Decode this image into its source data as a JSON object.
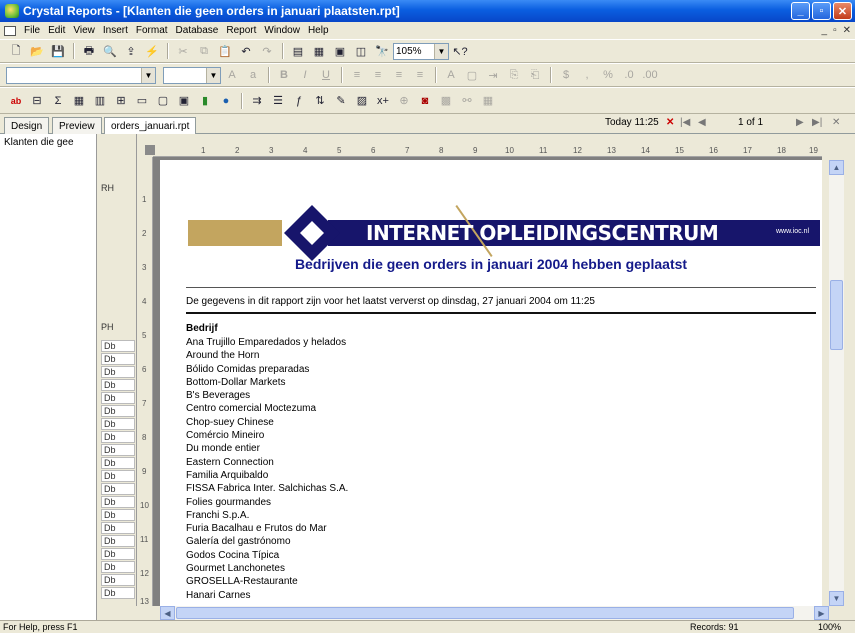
{
  "window": {
    "title": "Crystal Reports - [Klanten die geen orders in januari plaatsten.rpt]",
    "controls": [
      "_",
      "▫",
      "✕"
    ]
  },
  "menu": [
    "File",
    "Edit",
    "View",
    "Insert",
    "Format",
    "Database",
    "Report",
    "Window",
    "Help"
  ],
  "mdi_controls": [
    "_",
    "▫",
    "✕"
  ],
  "toolbar": {
    "zoom": "105%",
    "font_name": "",
    "font_size": ""
  },
  "tabs": {
    "design": "Design",
    "preview": "Preview",
    "file": "orders_januari.rpt"
  },
  "nav": {
    "timestamp": "Today 11:25",
    "page": "1 of 1"
  },
  "tree": {
    "root": "Klanten die gee"
  },
  "sections": {
    "rh": "RH",
    "ph": "PH",
    "db": "Db"
  },
  "report": {
    "brand": "INTERNET OPLEIDINGSCENTRUM",
    "url": "www.ioc.nl",
    "title": "Bedrijven die geen orders in januari 2004 hebben geplaatst",
    "subtitle": "De gegevens in dit rapport zijn voor het laatst ververst op dinsdag, 27 januari 2004 om 11:25",
    "column_header": "Bedrijf",
    "rows": [
      "Ana Trujillo Emparedados y helados",
      "Around the Horn",
      "Bólido Comidas preparadas",
      "Bottom-Dollar Markets",
      "B's Beverages",
      "Centro comercial Moctezuma",
      "Chop-suey Chinese",
      "Comércio Mineiro",
      "Du monde entier",
      "Eastern Connection",
      "Familia Arquibaldo",
      "FISSA Fabrica Inter. Salchichas S.A.",
      "Folies gourmandes",
      "Franchi S.p.A.",
      "Furia Bacalhau e Frutos do Mar",
      "Galería del gastrónomo",
      "Godos Cocina Típica",
      "Gourmet Lanchonetes",
      "GROSELLA-Restaurante",
      "Hanari Carnes"
    ]
  },
  "status": {
    "help": "For Help, press F1",
    "records": "Records: 91",
    "zoom": "100%"
  },
  "colors": {
    "title_blue": "#141a8a",
    "banner_navy": "#17156b",
    "banner_gold": "#c3a55f"
  }
}
